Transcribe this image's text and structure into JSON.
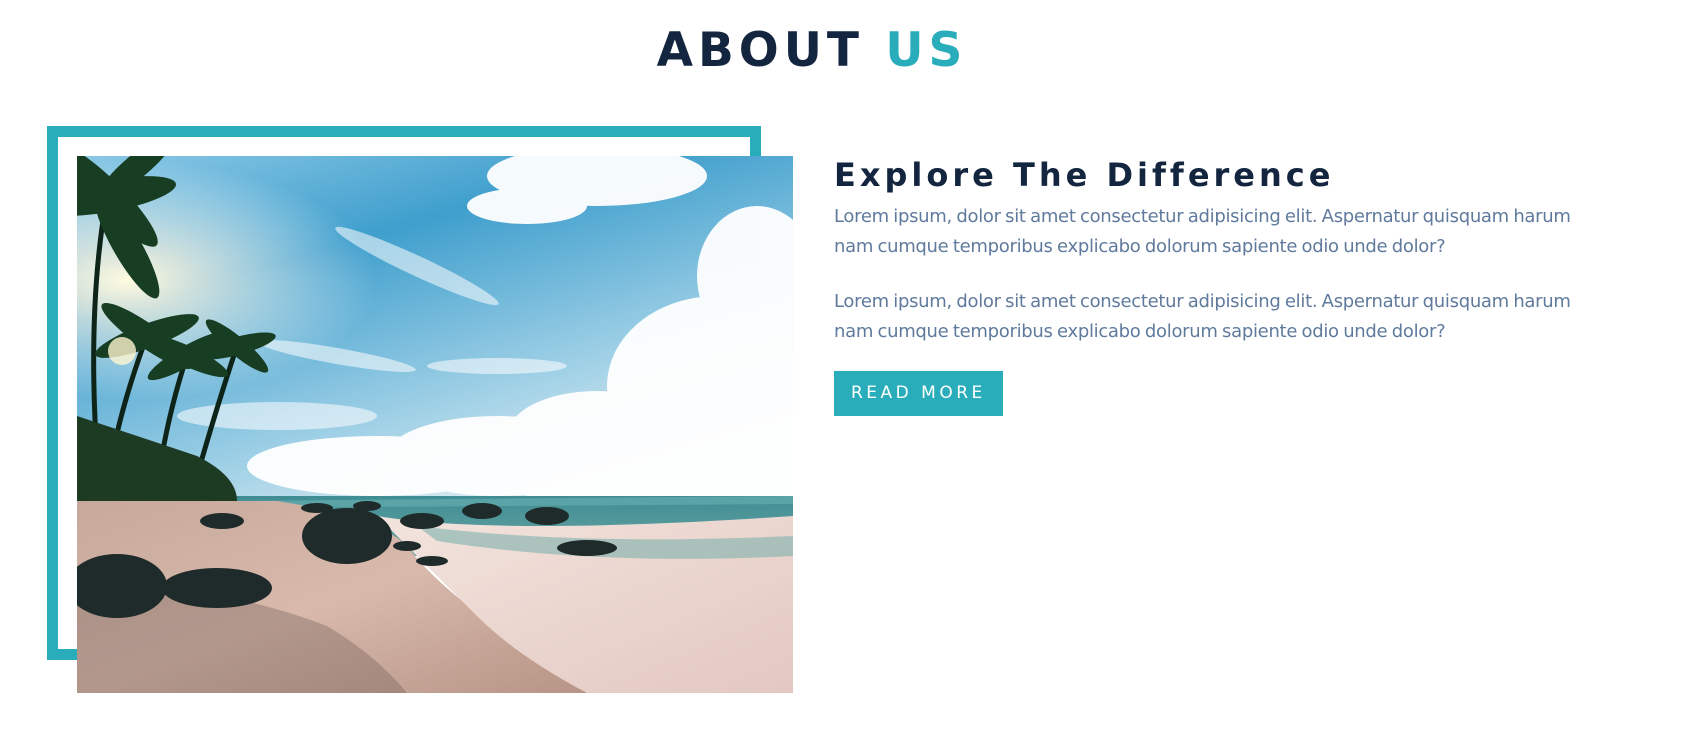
{
  "section": {
    "title_main": "ABOUT",
    "title_accent": "US"
  },
  "about": {
    "subtitle": "Explore The Difference",
    "paragraphs": [
      "Lorem ipsum, dolor sit amet consectetur adipisicing elit. Aspernatur quisquam harum nam cumque temporibus explicabo dolorum sapiente odio unde dolor?",
      "Lorem ipsum, dolor sit amet consectetur adipisicing elit. Aspernatur quisquam harum nam cumque temporibus explicabo dolorum sapiente odio unde dolor?"
    ],
    "button_label": "READ MORE"
  },
  "colors": {
    "accent": "#2aadbb",
    "heading": "#13253f",
    "body_text": "#5f7a9c"
  },
  "image": {
    "subject": "tropical beach with palm trees, rocks and cloudy sky"
  }
}
